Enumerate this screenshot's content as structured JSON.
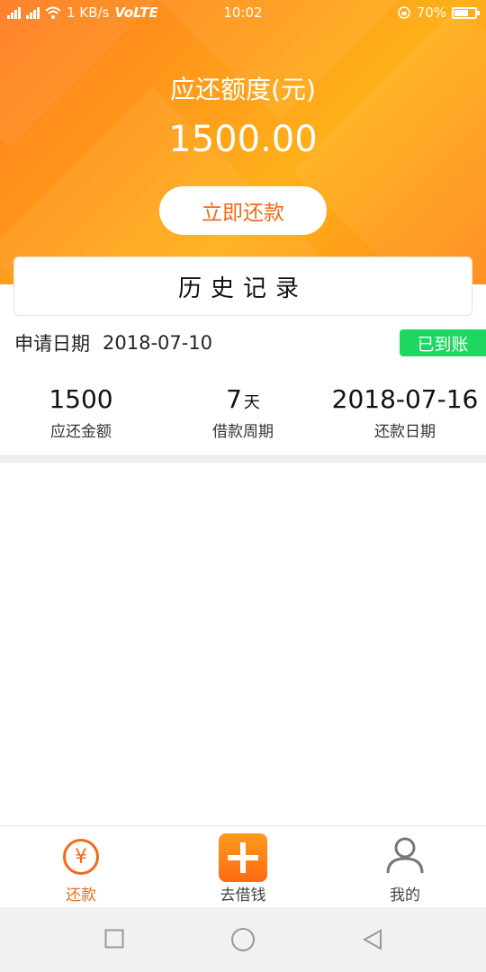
{
  "status_bar": {
    "network_speed": "1 KB/s",
    "volte": "VoLTE",
    "time": "10:02",
    "battery_percent": "70%",
    "battery_level": 0.7
  },
  "hero": {
    "amount_title": "应还额度(元)",
    "amount_value": "1500.00",
    "repay_button": "立即还款",
    "colors": {
      "accent": "#f26a1b",
      "gradient_start": "#ff7a1f",
      "gradient_end": "#ffb01a"
    }
  },
  "history": {
    "title": "历史记录"
  },
  "record": {
    "apply_label": "申请日期",
    "apply_date": "2018-07-10",
    "status": "已到账",
    "status_color": "#1ed760",
    "stats": [
      {
        "value": "1500",
        "unit": "",
        "label": "应还金额"
      },
      {
        "value": "7",
        "unit": "天",
        "label": "借款周期"
      },
      {
        "value": "2018-07-16",
        "unit": "",
        "label": "还款日期"
      }
    ]
  },
  "tabbar": {
    "tabs": [
      {
        "label": "还款",
        "icon": "yen-icon",
        "active": true
      },
      {
        "label": "去借钱",
        "icon": "plus-icon",
        "active": false
      },
      {
        "label": "我的",
        "icon": "user-icon",
        "active": false
      }
    ]
  },
  "system_nav": {
    "buttons": [
      "recent-apps-icon",
      "home-icon",
      "back-icon"
    ]
  }
}
